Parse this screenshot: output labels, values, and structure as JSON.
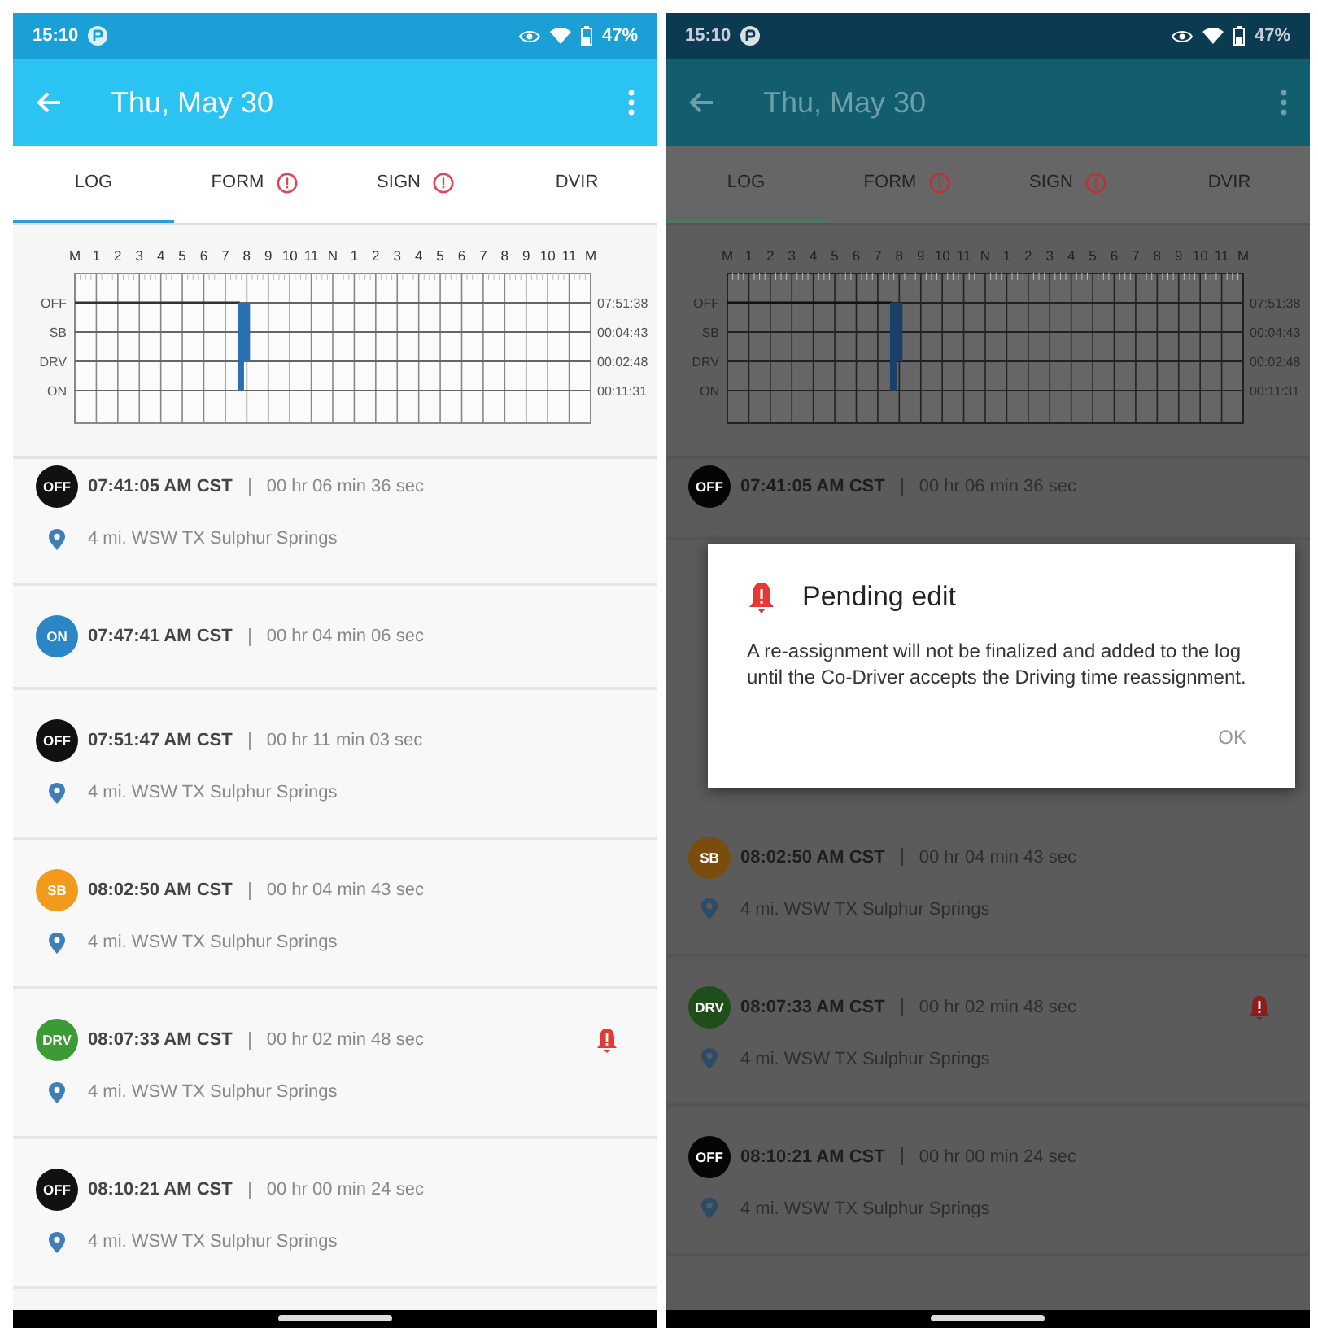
{
  "screens": [
    {
      "dimmed": false,
      "status_bar": {
        "time": "15:10",
        "battery": "47%"
      },
      "app_bar": {
        "title": "Thu, May 30"
      },
      "tabs": [
        {
          "label": "LOG",
          "selected": true,
          "alert": false
        },
        {
          "label": "FORM",
          "selected": false,
          "alert": true
        },
        {
          "label": "SIGN",
          "selected": false,
          "alert": true
        },
        {
          "label": "DVIR",
          "selected": false,
          "alert": false
        }
      ],
      "log_graph": {
        "hour_labels": [
          "M",
          "1",
          "2",
          "3",
          "4",
          "5",
          "6",
          "7",
          "8",
          "9",
          "10",
          "11",
          "N",
          "1",
          "2",
          "3",
          "4",
          "5",
          "6",
          "7",
          "8",
          "9",
          "10",
          "11",
          "M"
        ],
        "status_labels": [
          "OFF",
          "SB",
          "DRV",
          "ON"
        ],
        "totals": [
          "07:51:38",
          "00:04:43",
          "00:02:48",
          "00:11:31"
        ]
      },
      "events": [
        {
          "status": "OFF",
          "color": "#111111",
          "time": "07:41:05 AM CST",
          "duration": "00 hr 06 min 36 sec",
          "location": "4 mi. WSW TX Sulphur Springs",
          "alert": false
        },
        {
          "status": "ON",
          "color": "#2b86c5",
          "time": "07:47:41 AM CST",
          "duration": "00 hr 04 min 06 sec",
          "alert": false
        },
        {
          "status": "OFF",
          "color": "#111111",
          "time": "07:51:47 AM CST",
          "duration": "00 hr 11 min 03 sec",
          "location": "4 mi. WSW TX Sulphur Springs",
          "alert": false
        },
        {
          "status": "SB",
          "color": "#f29a1c",
          "time": "08:02:50 AM CST",
          "duration": "00 hr 04 min 43 sec",
          "location": "4 mi. WSW TX Sulphur Springs",
          "alert": false
        },
        {
          "status": "DRV",
          "color": "#3d9b35",
          "time": "08:07:33 AM CST",
          "duration": "00 hr 02 min 48 sec",
          "location": "4 mi. WSW TX Sulphur Springs",
          "alert": true
        },
        {
          "status": "OFF",
          "color": "#111111",
          "time": "08:10:21 AM CST",
          "duration": "00 hr 00 min 24 sec",
          "location": "4 mi. WSW TX Sulphur Springs",
          "alert": false
        }
      ]
    },
    {
      "dimmed": true,
      "status_bar": {
        "time": "15:10",
        "battery": "47%"
      },
      "app_bar": {
        "title": "Thu, May 30"
      },
      "tabs": [
        {
          "label": "LOG",
          "selected": true,
          "alert": false
        },
        {
          "label": "FORM",
          "selected": false,
          "alert": true
        },
        {
          "label": "SIGN",
          "selected": false,
          "alert": true
        },
        {
          "label": "DVIR",
          "selected": false,
          "alert": false
        }
      ],
      "log_graph": {
        "hour_labels": [
          "M",
          "1",
          "2",
          "3",
          "4",
          "5",
          "6",
          "7",
          "8",
          "9",
          "10",
          "11",
          "N",
          "1",
          "2",
          "3",
          "4",
          "5",
          "6",
          "7",
          "8",
          "9",
          "10",
          "11",
          "M"
        ],
        "status_labels": [
          "OFF",
          "SB",
          "DRV",
          "ON"
        ],
        "totals": [
          "07:51:38",
          "00:04:43",
          "00:02:48",
          "00:11:31"
        ]
      },
      "events": [
        {
          "status": "OFF",
          "color": "#050505",
          "time": "07:41:05 AM CST",
          "duration": "00 hr 06 min 36 sec",
          "alert": false
        }
      ],
      "dialog": {
        "title": "Pending edit",
        "message": "A re-assignment will not be finalized and added to the log until the Co-Driver accepts the Driving time reassignment.",
        "button": "OK"
      },
      "events_below": [
        {
          "status": "SB",
          "color": "#7a4d0e",
          "time": "08:02:50 AM CST",
          "duration": "00 hr 04 min 43 sec",
          "location": "4 mi. WSW TX Sulphur Springs",
          "alert": false
        },
        {
          "status": "DRV",
          "color": "#1f4e1b",
          "time": "08:07:33 AM CST",
          "duration": "00 hr 02 min 48 sec",
          "location": "4 mi. WSW TX Sulphur Springs",
          "alert": true
        },
        {
          "status": "OFF",
          "color": "#050505",
          "time": "08:10:21 AM CST",
          "duration": "00 hr 00 min 24 sec",
          "location": "4 mi. WSW TX Sulphur Springs",
          "alert": false
        }
      ]
    }
  ]
}
